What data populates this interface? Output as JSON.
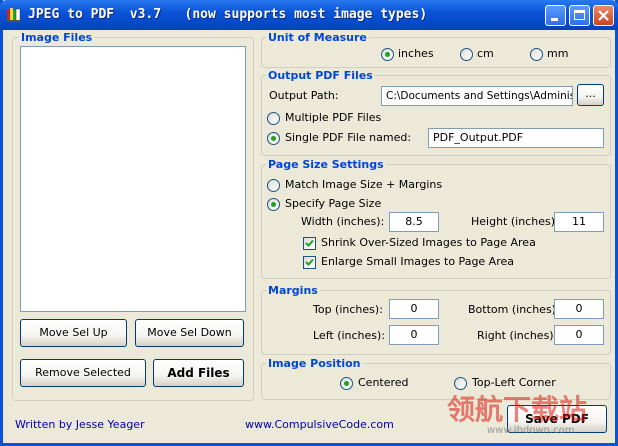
{
  "window": {
    "title": "JPEG to PDF  v3.7   (now supports most image types)"
  },
  "image_files": {
    "title": "Image Files",
    "buttons": {
      "move_up": "Move Sel Up",
      "move_down": "Move Sel Down",
      "remove": "Remove Selected",
      "add": "Add Files"
    }
  },
  "unit": {
    "title": "Unit of Measure",
    "options": [
      "inches",
      "cm",
      "mm"
    ],
    "selected": "inches"
  },
  "output": {
    "title": "Output PDF Files",
    "path_label": "Output Path:",
    "path_value": "C:\\Documents and Settings\\Administrat",
    "browse_label": "...",
    "multiple_label": "Multiple PDF Files",
    "single_label": "Single PDF File named:",
    "single_value": "PDF_Output.PDF",
    "selected": "single"
  },
  "page_size": {
    "title": "Page Size Settings",
    "match_label": "Match Image Size + Margins",
    "specify_label": "Specify Page Size",
    "selected": "specify",
    "width_label": "Width (inches):",
    "width_value": "8.5",
    "height_label": "Height (inches):",
    "height_value": "11",
    "shrink_label": "Shrink Over-Sized Images to Page Area",
    "shrink_checked": true,
    "enlarge_label": "Enlarge Small Images to Page Area",
    "enlarge_checked": true
  },
  "margins": {
    "title": "Margins",
    "top_label": "Top (inches):",
    "top_value": "0",
    "bottom_label": "Bottom (inches):",
    "bottom_value": "0",
    "left_label": "Left (inches):",
    "left_value": "0",
    "right_label": "Right (inches):",
    "right_value": "0"
  },
  "position": {
    "title": "Image Position",
    "centered_label": "Centered",
    "topleft_label": "Top-Left Corner",
    "selected": "centered"
  },
  "footer": {
    "author": "Written by Jesse Yeager",
    "website": "www.CompulsiveCode.com",
    "save_label": "Save PDF"
  },
  "watermark": {
    "text": "领航下载站",
    "url": "www.lhdown.com"
  },
  "colors": {
    "group_title": "#0046D5",
    "window_bg": "#ECE9D8",
    "titlebar": "#0A53D8",
    "radio_dot": "#21A121"
  }
}
